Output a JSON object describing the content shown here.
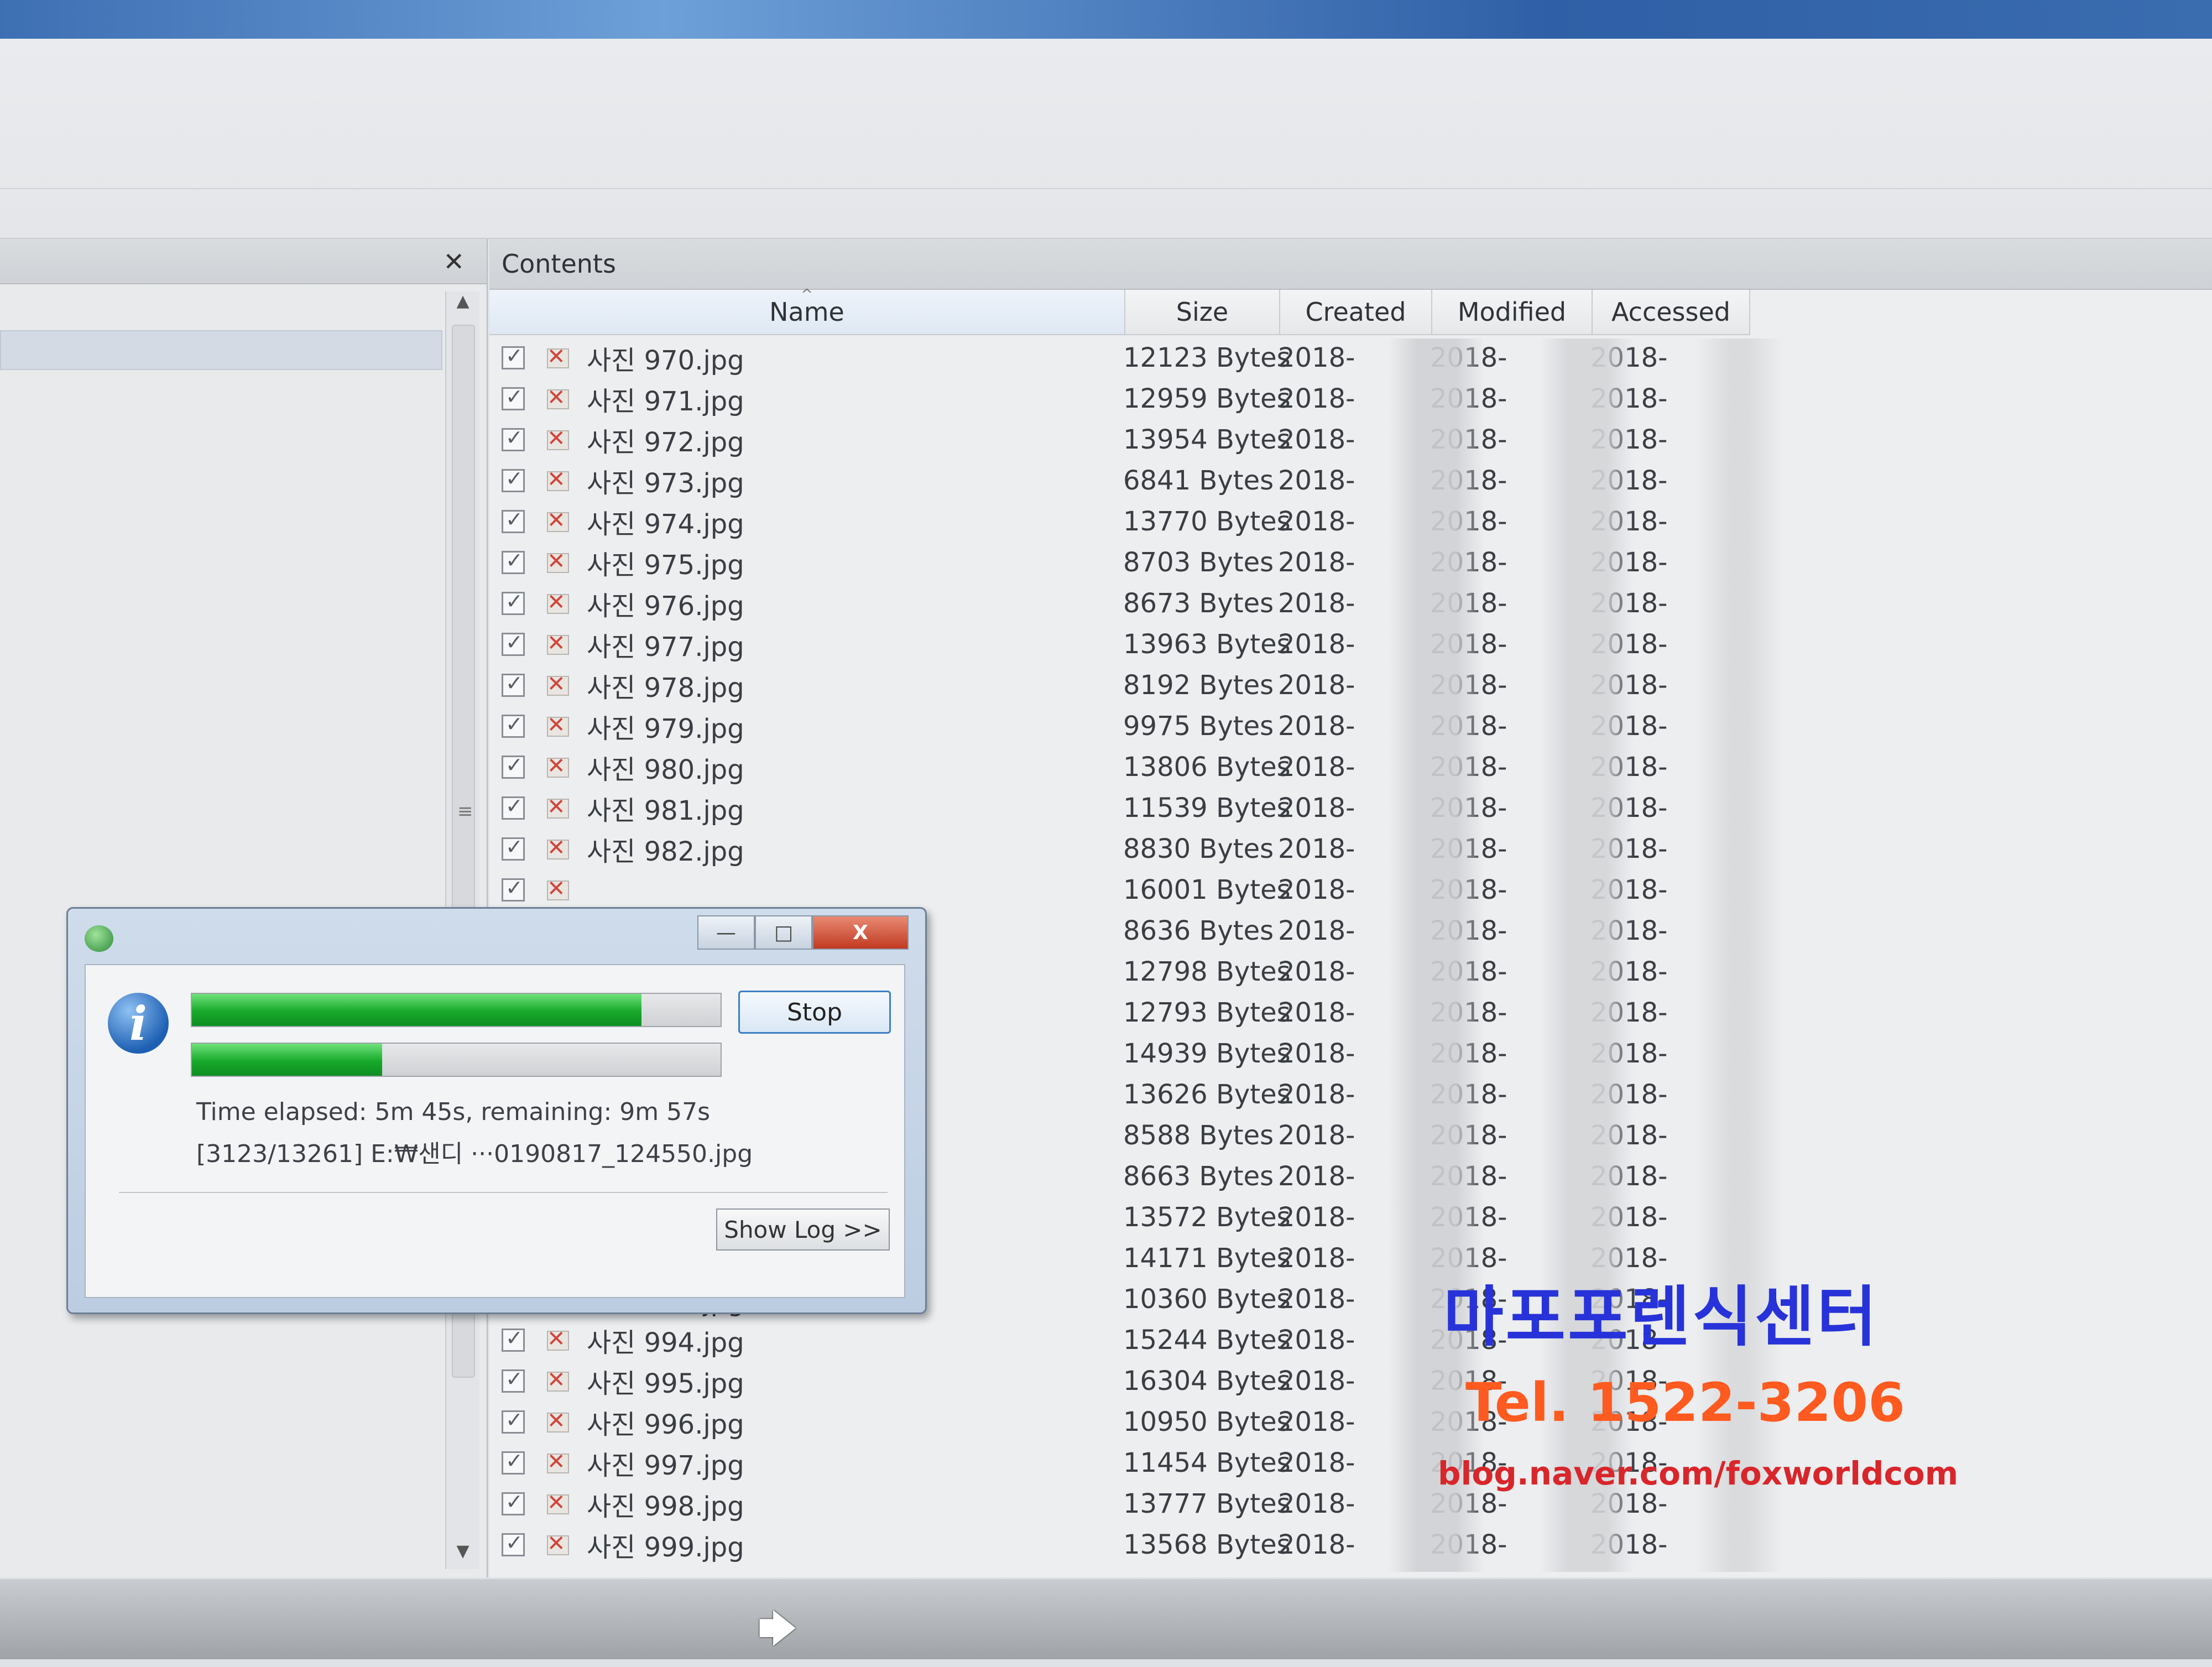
{
  "left_panel": {
    "close_label": "✕",
    "scroll_up": "▲",
    "scroll_down": "▼",
    "grip": "≡"
  },
  "contents": {
    "title": "Contents",
    "columns": {
      "name": "Name",
      "size": "Size",
      "created": "Created",
      "modified": "Modified",
      "accessed": "Accessed"
    },
    "sort_indicator": "^",
    "rows": [
      {
        "name": "사진 970.jpg",
        "size": "12123 Bytes",
        "created": "2018-",
        "modified": "2018-",
        "accessed": "2018-"
      },
      {
        "name": "사진 971.jpg",
        "size": "12959 Bytes",
        "created": "2018-",
        "modified": "2018-",
        "accessed": "2018-"
      },
      {
        "name": "사진 972.jpg",
        "size": "13954 Bytes",
        "created": "2018-",
        "modified": "2018-",
        "accessed": "2018-"
      },
      {
        "name": "사진 973.jpg",
        "size": "6841 Bytes",
        "created": "2018-",
        "modified": "2018-",
        "accessed": "2018-"
      },
      {
        "name": "사진 974.jpg",
        "size": "13770 Bytes",
        "created": "2018-",
        "modified": "2018-",
        "accessed": "2018-"
      },
      {
        "name": "사진 975.jpg",
        "size": "8703 Bytes",
        "created": "2018-",
        "modified": "2018-",
        "accessed": "2018-"
      },
      {
        "name": "사진 976.jpg",
        "size": "8673 Bytes",
        "created": "2018-",
        "modified": "2018-",
        "accessed": "2018-"
      },
      {
        "name": "사진 977.jpg",
        "size": "13963 Bytes",
        "created": "2018-",
        "modified": "2018-",
        "accessed": "2018-"
      },
      {
        "name": "사진 978.jpg",
        "size": "8192 Bytes",
        "created": "2018-",
        "modified": "2018-",
        "accessed": "2018-"
      },
      {
        "name": "사진 979.jpg",
        "size": "9975 Bytes",
        "created": "2018-",
        "modified": "2018-",
        "accessed": "2018-"
      },
      {
        "name": "사진 980.jpg",
        "size": "13806 Bytes",
        "created": "2018-",
        "modified": "2018-",
        "accessed": "2018-"
      },
      {
        "name": "사진 981.jpg",
        "size": "11539 Bytes",
        "created": "2018-",
        "modified": "2018-",
        "accessed": "2018-"
      },
      {
        "name": "사진 982.jpg",
        "size": "8830 Bytes",
        "created": "2018-",
        "modified": "2018-",
        "accessed": "2018-"
      },
      {
        "name": "",
        "size": "16001 Bytes",
        "created": "2018-",
        "modified": "2018-",
        "accessed": "2018-"
      },
      {
        "name": "",
        "size": "8636 Bytes",
        "created": "2018-",
        "modified": "2018-",
        "accessed": "2018-"
      },
      {
        "name": "",
        "size": "12798 Bytes",
        "created": "2018-",
        "modified": "2018-",
        "accessed": "2018-"
      },
      {
        "name": "",
        "size": "12793 Bytes",
        "created": "2018-",
        "modified": "2018-",
        "accessed": "2018-"
      },
      {
        "name": "",
        "size": "14939 Bytes",
        "created": "2018-",
        "modified": "2018-",
        "accessed": "2018-"
      },
      {
        "name": "",
        "size": "13626 Bytes",
        "created": "2018-",
        "modified": "2018-",
        "accessed": "2018-"
      },
      {
        "name": "",
        "size": "8588 Bytes",
        "created": "2018-",
        "modified": "2018-",
        "accessed": "2018-"
      },
      {
        "name": "",
        "size": "8663 Bytes",
        "created": "2018-",
        "modified": "2018-",
        "accessed": "2018-"
      },
      {
        "name": "",
        "size": "13572 Bytes",
        "created": "2018-",
        "modified": "2018-",
        "accessed": "2018-"
      },
      {
        "name": "",
        "size": "14171 Bytes",
        "created": "2018-",
        "modified": "2018-",
        "accessed": "2018-"
      },
      {
        "name": "사진 993.jpg",
        "size": "10360 Bytes",
        "created": "2018-",
        "modified": "2018-",
        "accessed": "2018-"
      },
      {
        "name": "사진 994.jpg",
        "size": "15244 Bytes",
        "created": "2018-",
        "modified": "2018-",
        "accessed": "2018-"
      },
      {
        "name": "사진 995.jpg",
        "size": "16304 Bytes",
        "created": "2018-",
        "modified": "2018-",
        "accessed": "2018-"
      },
      {
        "name": "사진 996.jpg",
        "size": "10950 Bytes",
        "created": "2018-",
        "modified": "2018-",
        "accessed": "2018-"
      },
      {
        "name": "사진 997.jpg",
        "size": "11454 Bytes",
        "created": "2018-",
        "modified": "2018-",
        "accessed": "2018-"
      },
      {
        "name": "사진 998.jpg",
        "size": "13777 Bytes",
        "created": "2018-",
        "modified": "2018-",
        "accessed": "2018-"
      },
      {
        "name": "사진 999.jpg",
        "size": "13568 Bytes",
        "created": "2018-",
        "modified": "2018-",
        "accessed": "2018-"
      }
    ]
  },
  "progress_dialog": {
    "minimize_label": "—",
    "maximize_label": "□",
    "close_label": "X",
    "info_icon_glyph": "i",
    "overall_progress_fraction": 0.85,
    "file_progress_fraction": 0.36,
    "stop_label": "Stop",
    "time_text": "Time elapsed: 5m 45s, remaining: 9m 57s",
    "file_text": "[3123/13261] E:₩샌디 ···0190817_124550.jpg",
    "show_log_label": "Show Log >>"
  },
  "watermark": {
    "name": "마포포렌식센터",
    "tel": "Tel. 1522-3206",
    "blog": "blog.naver.com/foxworldcom"
  },
  "colors": {
    "progress_green": "#17a92a",
    "watermark_blue": "#2733d9",
    "watermark_orange": "#ff5a1f",
    "watermark_red": "#d8262b"
  }
}
